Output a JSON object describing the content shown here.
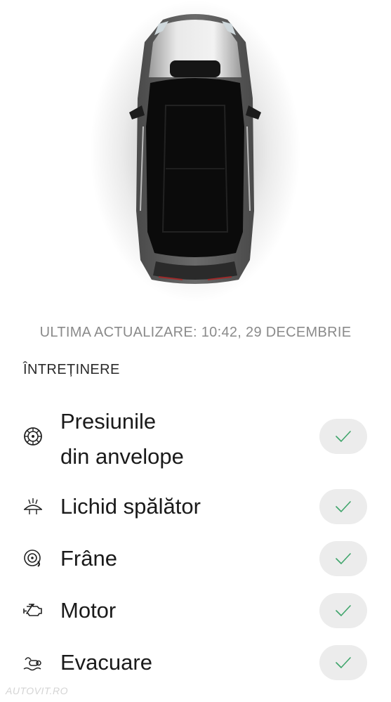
{
  "status": {
    "last_update": "ULTIMA ACTUALIZARE: 10:42, 29 DECEMBRIE"
  },
  "maintenance": {
    "title": "ÎNTREȚINERE",
    "items": [
      {
        "line1": "Presiunile",
        "line2": "din anvelope",
        "icon": "tire-icon",
        "status": "ok"
      },
      {
        "line1": "Lichid spălător",
        "icon": "washer-fluid-icon",
        "status": "ok"
      },
      {
        "line1": "Frâne",
        "icon": "brake-icon",
        "status": "ok"
      },
      {
        "line1": "Motor",
        "icon": "engine-icon",
        "status": "ok"
      },
      {
        "line1": "Evacuare",
        "icon": "exhaust-icon",
        "status": "ok"
      }
    ]
  },
  "watermark": "AUTOVIT.RO",
  "colors": {
    "check": "#3fa56b",
    "pill": "#ececec",
    "muted_text": "#8a8a8a"
  }
}
